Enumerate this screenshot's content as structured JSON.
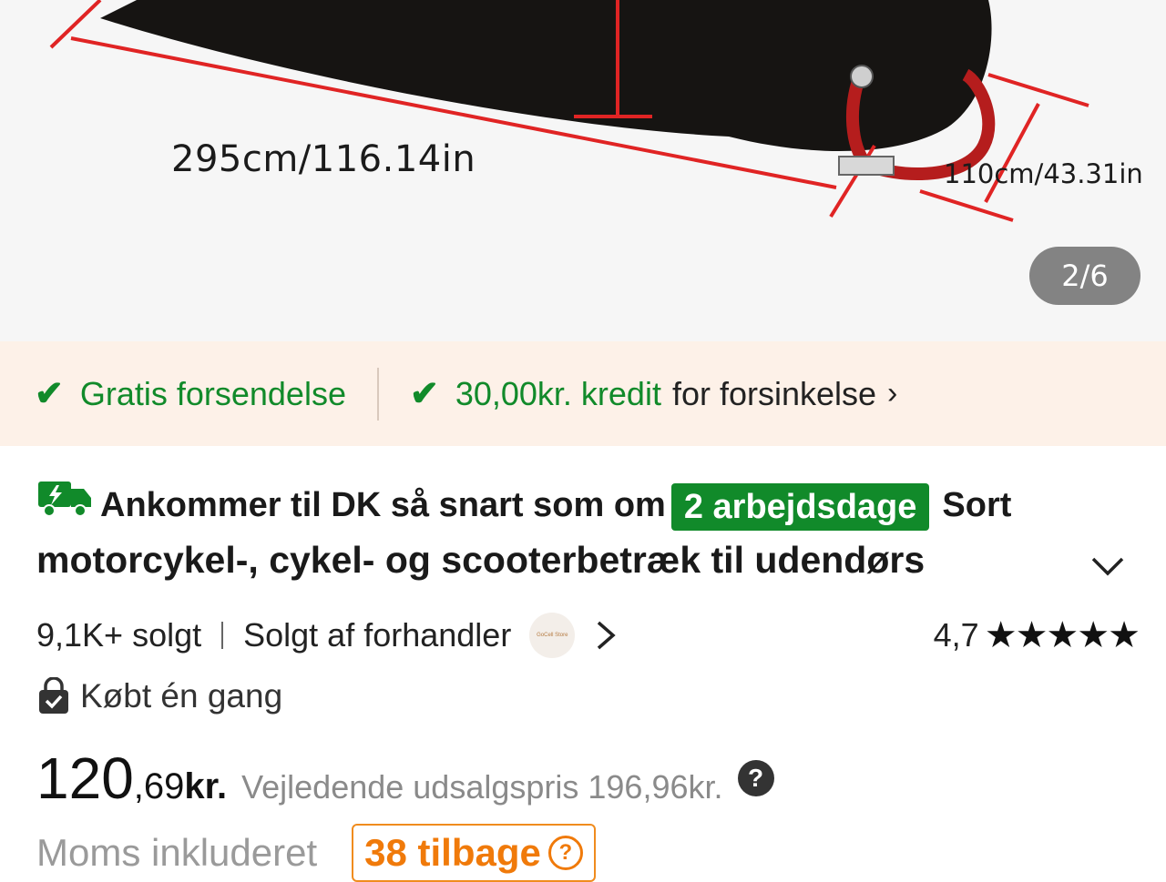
{
  "gallery": {
    "dimension_length": "295cm/116.14in",
    "dimension_height": "110cm/43.31in",
    "page_counter": "2/6"
  },
  "benefits": {
    "free_shipping": "Gratis forsendelse",
    "credit_amount": "30,00kr. kredit",
    "credit_suffix": "for forsinkelse",
    "check_icon": "check-icon",
    "chevron_icon": "chevron-right-icon"
  },
  "product": {
    "arrival_text": "Ankommer til DK så snart som om",
    "arrival_badge": "2 arbejdsdage",
    "title_start": "Sort",
    "title_line2": "motorcykel-, cykel- og scooterbetræk til udendørs",
    "sold": "9,1K+ solgt",
    "seller": "Solgt af forhandler",
    "seller_logo_text": "GoCell Store",
    "rating": "4,7",
    "stars": "★★★★★",
    "bought_once": "Købt én gang"
  },
  "price": {
    "integer": "120",
    "decimal": ",69",
    "currency": "kr.",
    "rrp_label": "Vejledende udsalgspris",
    "rrp_value": "196,96kr.",
    "vat": "Moms inkluderet",
    "cashback": "38 tilbage"
  },
  "colors": {
    "green": "#118a2a",
    "orange": "#f07a0a",
    "benefits_bg": "#fdf1e8",
    "dimension_red": "#e02424"
  }
}
